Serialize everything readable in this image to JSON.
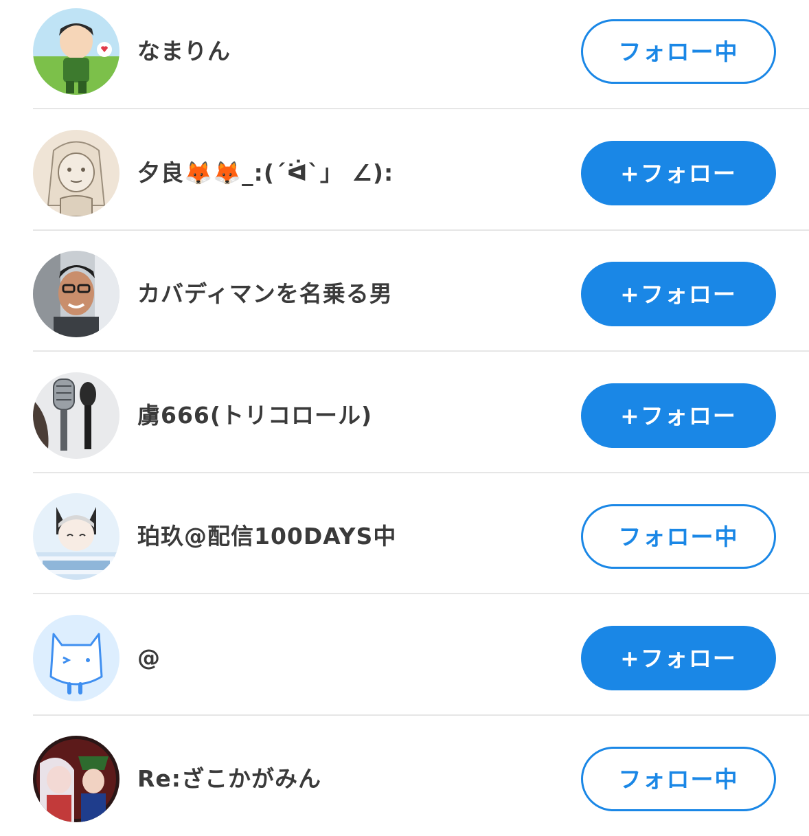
{
  "colors": {
    "accent": "#1a87e6",
    "name_text": "#3a3a3a",
    "divider": "#e6e6e6"
  },
  "users": [
    {
      "name": "なまりん",
      "button_label": "フォロー中",
      "state": "following",
      "avatar": "avatar-chibi-character"
    },
    {
      "name": "夕良🦊🦊_:(´ᐛ`」 ∠):",
      "button_label": "+フォロー",
      "state": "follow",
      "avatar": "avatar-sketch-girl"
    },
    {
      "name": "カバディマンを名乗る男",
      "button_label": "+フォロー",
      "state": "follow",
      "avatar": "avatar-selfie-glasses"
    },
    {
      "name": "虜666(トリコロール)",
      "button_label": "+フォロー",
      "state": "follow",
      "avatar": "avatar-microphones"
    },
    {
      "name": "珀玖@配信100DAYS中",
      "button_label": "フォロー中",
      "state": "following",
      "avatar": "avatar-stream-banner"
    },
    {
      "name": "@",
      "button_label": "+フォロー",
      "state": "follow",
      "avatar": "avatar-default-cat"
    },
    {
      "name": "Re:ざこかがみん",
      "button_label": "フォロー中",
      "state": "following",
      "avatar": "avatar-anime-duo"
    }
  ]
}
